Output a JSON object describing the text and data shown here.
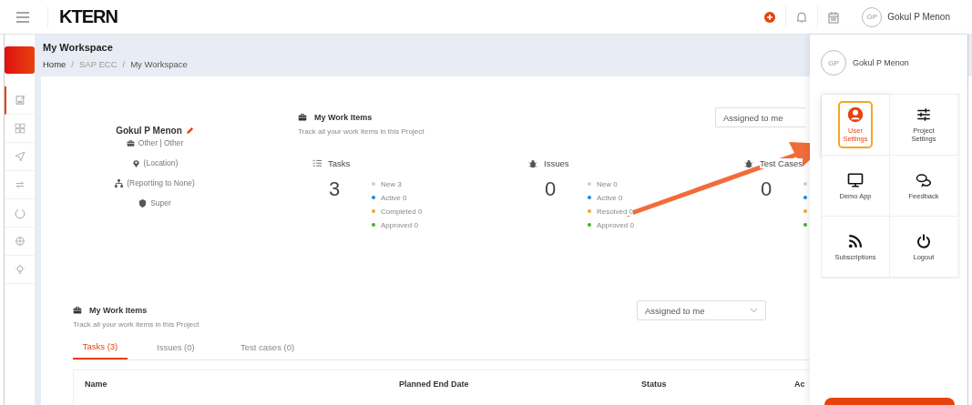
{
  "topbar": {
    "logo": "KTERN",
    "user": {
      "initials": "GP",
      "name": "Gokul P Menon"
    }
  },
  "page": {
    "title": "My Workspace",
    "breadcrumb": [
      "Home",
      "SAP ECC",
      "My Workspace"
    ],
    "separators": [
      "/",
      "/"
    ]
  },
  "sidebar": {
    "items": [
      {
        "selected": true
      },
      {
        "selected": false
      },
      {
        "selected": false
      },
      {
        "selected": false
      },
      {
        "selected": false
      },
      {
        "selected": false
      },
      {
        "selected": false
      }
    ]
  },
  "profile": {
    "name": "Gokul P Menon",
    "role": "Other | Other",
    "location": "(Location)",
    "reporting": "(Reporting to None)",
    "access": "Super"
  },
  "summary": {
    "title": "My Work Items",
    "subtitle": "Track all your work items in this Project",
    "filter": "Assigned to me",
    "groups": [
      {
        "label": "Tasks",
        "count": "3",
        "legend": [
          {
            "label": "New 3",
            "color": "#d0d0d0"
          },
          {
            "label": "Active 0",
            "color": "#1e88e5"
          },
          {
            "label": "Completed 0",
            "color": "#f5a623"
          },
          {
            "label": "Approved 0",
            "color": "#43b02a"
          }
        ]
      },
      {
        "label": "Issues",
        "count": "0",
        "legend": [
          {
            "label": "New 0",
            "color": "#d0d0d0"
          },
          {
            "label": "Active 0",
            "color": "#1e88e5"
          },
          {
            "label": "Resolved 0",
            "color": "#f5a623"
          },
          {
            "label": "Approved 0",
            "color": "#43b02a"
          }
        ]
      },
      {
        "label": "Test Cases",
        "count": "0",
        "legend": [
          {
            "color": "#d0d0d0"
          },
          {
            "color": "#1e88e5"
          },
          {
            "color": "#f5a623"
          },
          {
            "color": "#43b02a"
          }
        ]
      }
    ]
  },
  "work_items": {
    "title": "My Work Items",
    "subtitle": "Track all your work items in this Project",
    "filter": "Assigned to me",
    "tabs": [
      {
        "label": "Tasks (3)",
        "selected": true
      },
      {
        "label": "Issues (0)",
        "selected": false
      },
      {
        "label": "Test cases (0)",
        "selected": false
      }
    ],
    "table": {
      "columns": [
        "Name",
        "Planned End Date",
        "Status",
        "Ac"
      ]
    }
  },
  "user_menu": {
    "user": {
      "initials": "GP",
      "name": "Gokul P Menon"
    },
    "tiles": [
      {
        "label": "User Settings",
        "selected": true
      },
      {
        "label": "Project Settings",
        "selected": false
      },
      {
        "label": "Demo App",
        "selected": false
      },
      {
        "label": "Feedback",
        "selected": false
      },
      {
        "label": "Subscriptions",
        "selected": false
      },
      {
        "label": "Logout",
        "selected": false
      }
    ]
  }
}
